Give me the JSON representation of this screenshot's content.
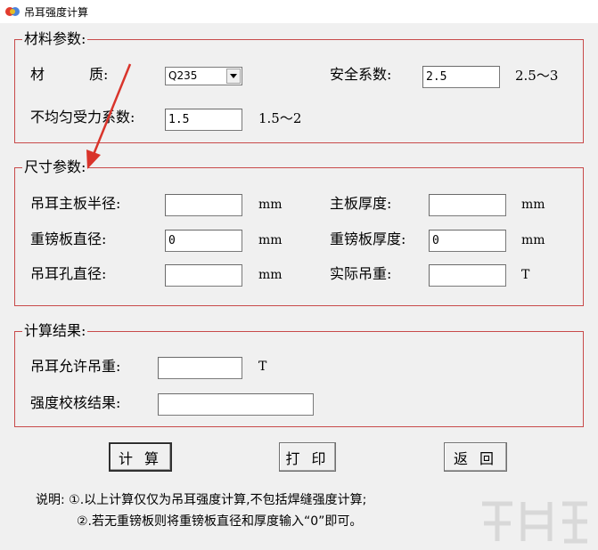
{
  "window": {
    "title": "吊耳强度计算"
  },
  "material": {
    "legend": "材料参数:",
    "material_label_a": "材",
    "material_label_b": "质:",
    "material_value": "Q235",
    "safety_label": "安全系数:",
    "safety_value": "2.5",
    "safety_range": "2.5～3",
    "uneven_label": "不均匀受力系数:",
    "uneven_value": "1.5",
    "uneven_range": "1.5～2"
  },
  "size": {
    "legend": "尺寸参数:",
    "main_radius_label": "吊耳主板半径:",
    "main_radius_value": "",
    "main_radius_unit": "mm",
    "main_thickness_label": "主板厚度:",
    "main_thickness_value": "",
    "main_thickness_unit": "mm",
    "pad_diameter_label": "重镑板直径:",
    "pad_diameter_value": "0",
    "pad_diameter_unit": "mm",
    "pad_thickness_label": "重镑板厚度:",
    "pad_thickness_value": "0",
    "pad_thickness_unit": "mm",
    "hole_diameter_label": "吊耳孔直径:",
    "hole_diameter_value": "",
    "hole_diameter_unit": "mm",
    "actual_load_label": "实际吊重:",
    "actual_load_value": "",
    "actual_load_unit": "T"
  },
  "result": {
    "legend": "计算结果:",
    "allowed_load_label": "吊耳允许吊重:",
    "allowed_load_value": "",
    "allowed_load_unit": "T",
    "check_label": "强度校核结果:",
    "check_value": ""
  },
  "buttons": {
    "calculate": "计 算",
    "print": "打 印",
    "back": "返 回"
  },
  "notes": {
    "line1": "说明: ①.以上计算仅仅为吊耳强度计算,不包括焊缝强度计算;",
    "line2": "②.若无重镑板则将重镑板直径和厚度输入“0”即可。"
  },
  "colors": {
    "group_border": "#c84a4a",
    "annotation_arrow": "#d9342b",
    "window_bg": "#f0f0f0"
  }
}
